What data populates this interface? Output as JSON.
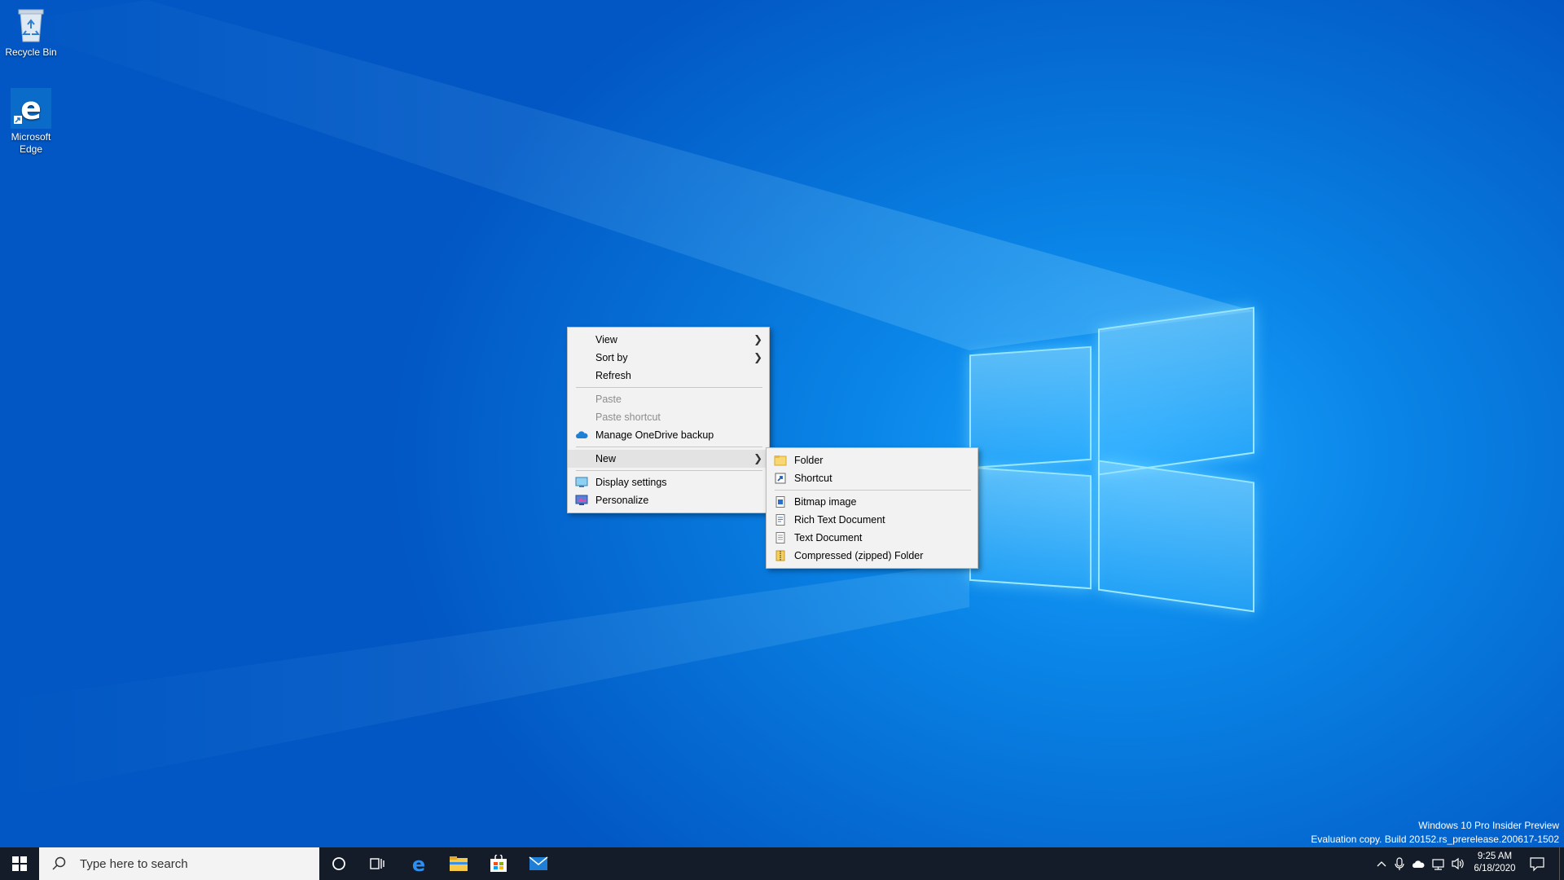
{
  "desktop": {
    "icons": [
      {
        "label": "Recycle Bin",
        "icon": "recycle-bin-icon"
      },
      {
        "label": "Microsoft Edge",
        "icon": "edge-icon"
      }
    ]
  },
  "context_menu": {
    "items": [
      {
        "label": "View",
        "submenu": true
      },
      {
        "label": "Sort by",
        "submenu": true
      },
      {
        "label": "Refresh"
      },
      {
        "label": "Paste",
        "disabled": true
      },
      {
        "label": "Paste shortcut",
        "disabled": true
      },
      {
        "label": "Manage OneDrive backup",
        "icon": "onedrive-icon"
      },
      {
        "label": "New",
        "submenu": true,
        "active": true
      },
      {
        "label": "Display settings",
        "icon": "display-icon"
      },
      {
        "label": "Personalize",
        "icon": "personalize-icon"
      }
    ]
  },
  "new_submenu": {
    "items": [
      {
        "label": "Folder",
        "icon": "folder-icon"
      },
      {
        "label": "Shortcut",
        "icon": "shortcut-icon"
      },
      {
        "label": "Bitmap image",
        "icon": "bitmap-icon"
      },
      {
        "label": "Rich Text Document",
        "icon": "rtf-icon"
      },
      {
        "label": "Text Document",
        "icon": "text-doc-icon"
      },
      {
        "label": "Compressed (zipped) Folder",
        "icon": "zip-folder-icon"
      }
    ]
  },
  "watermark": {
    "line1": "Windows 10 Pro Insider Preview",
    "line2": "Evaluation copy. Build 20152.rs_prerelease.200617-1502"
  },
  "taskbar": {
    "search_placeholder": "Type here to search",
    "clock_time": "9:25 AM",
    "clock_date": "6/18/2020",
    "pinned": [
      "cortana-icon",
      "task-view-icon",
      "edge-icon",
      "file-explorer-icon",
      "store-icon",
      "mail-icon"
    ]
  },
  "colors": {
    "desktop_blue": "#0a86e8",
    "taskbar": "#141c29",
    "menu_bg": "#f2f2f2"
  }
}
